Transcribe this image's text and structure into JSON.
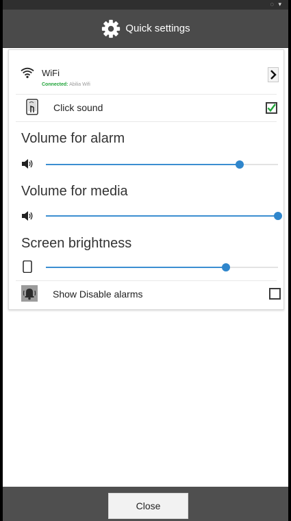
{
  "statusbar": {
    "icons": "◌ ▾"
  },
  "header": {
    "title": "Quick settings",
    "icon": "gear-icon"
  },
  "wifi": {
    "label": "WiFi",
    "status_prefix": "Connected:",
    "network": "Abilia Wifi",
    "arrow": "›"
  },
  "click_sound": {
    "label": "Click sound",
    "checked": true
  },
  "volume_alarm": {
    "title": "Volume for alarm",
    "level": 0.835
  },
  "volume_media": {
    "title": "Volume for media",
    "level": 1.0
  },
  "brightness": {
    "title": "Screen brightness",
    "level": 0.775
  },
  "show_disable_alarms": {
    "label": "Show Disable alarms",
    "checked": false
  },
  "footer": {
    "close_label": "Close"
  },
  "colors": {
    "accent": "#2f86cc",
    "check": "#21a43a",
    "bar": "#4a4a4a"
  }
}
